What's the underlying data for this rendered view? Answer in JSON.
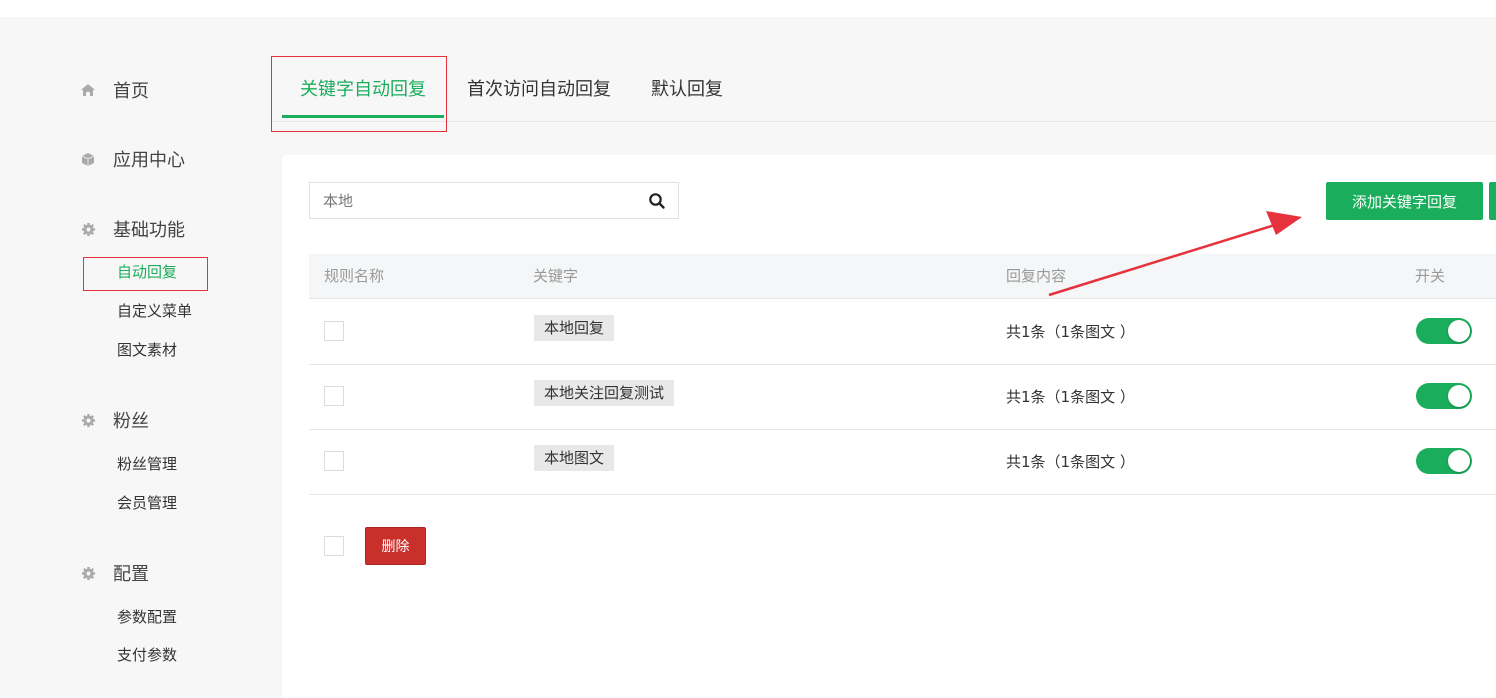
{
  "colors": {
    "accent": "#1aad5b",
    "danger": "#c9302c",
    "highlight_box": "#e5323d"
  },
  "sidebar": {
    "sections": [
      {
        "label": "首页",
        "icon": "home-icon"
      },
      {
        "label": "应用中心",
        "icon": "cube-icon",
        "items": []
      },
      {
        "label": "基础功能",
        "icon": "gear-icon",
        "items": [
          {
            "label": "自动回复",
            "active": true
          },
          {
            "label": "自定义菜单"
          },
          {
            "label": "图文素材"
          }
        ]
      },
      {
        "label": "粉丝",
        "icon": "gear-icon",
        "items": [
          {
            "label": "粉丝管理"
          },
          {
            "label": "会员管理"
          }
        ]
      },
      {
        "label": "配置",
        "icon": "gear-icon",
        "items": [
          {
            "label": "参数配置"
          },
          {
            "label": "支付参数"
          }
        ]
      }
    ]
  },
  "tabs": [
    {
      "label": "关键字自动回复",
      "active": true
    },
    {
      "label": "首次访问自动回复"
    },
    {
      "label": "默认回复"
    }
  ],
  "search": {
    "value": "",
    "placeholder": "本地"
  },
  "add_button": "添加关键字回复",
  "table": {
    "headers": [
      "规则名称",
      "关键字",
      "回复内容",
      "开关"
    ],
    "rows": [
      {
        "keyword": "本地回复",
        "content": "共1条（1条图文 ）",
        "enabled": true
      },
      {
        "keyword": "本地关注回复测试",
        "content": "共1条（1条图文 ）",
        "enabled": true
      },
      {
        "keyword": "本地图文",
        "content": "共1条（1条图文 ）",
        "enabled": true
      }
    ]
  },
  "delete_button": "删除"
}
